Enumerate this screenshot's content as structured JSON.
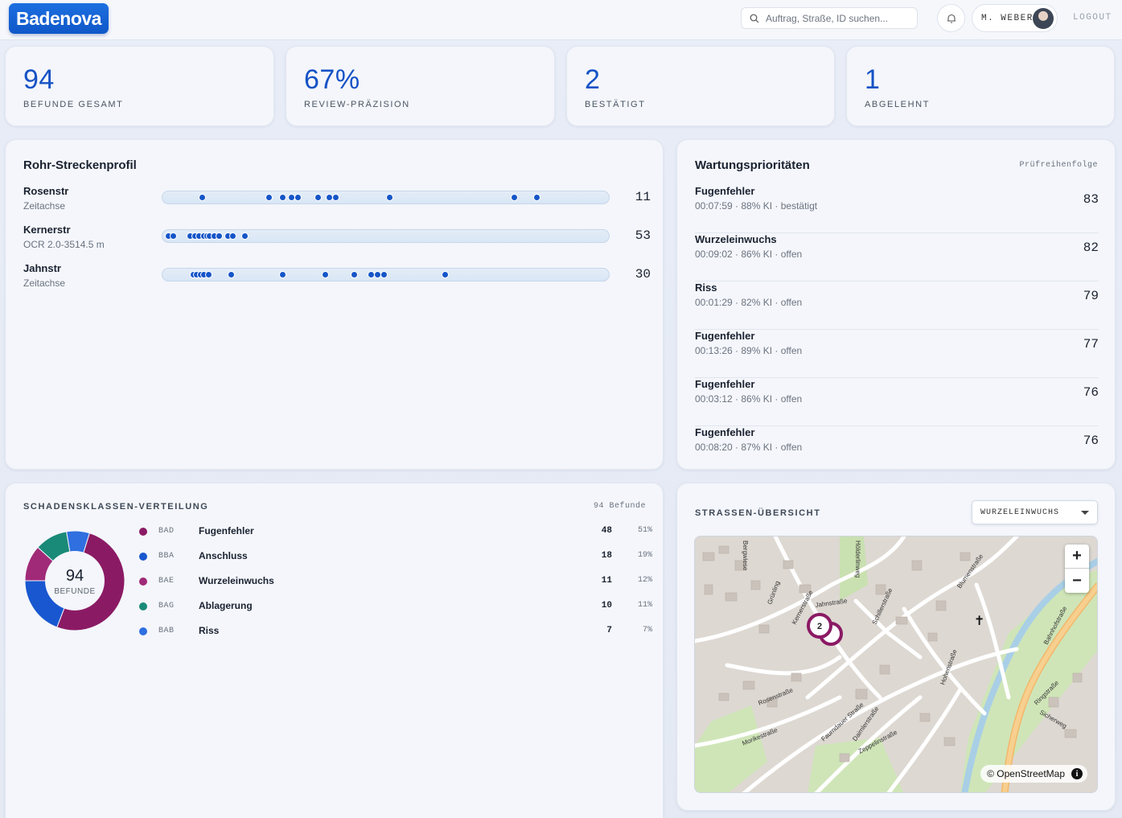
{
  "header": {
    "logo": "Badenova",
    "search_placeholder": "Auftrag, Straße, ID suchen...",
    "user": "M. WEBER",
    "logout": "LOGOUT"
  },
  "kpis": [
    {
      "value": "94",
      "label": "BEFUNDE GESAMT"
    },
    {
      "value": "67%",
      "label": "REVIEW-PRÄZISION"
    },
    {
      "value": "2",
      "label": "BESTÄTIGT"
    },
    {
      "value": "1",
      "label": "ABGELEHNT"
    }
  ],
  "profile": {
    "title": "Rohr-Streckenprofil",
    "rows": [
      {
        "name": "Rosenstr",
        "sub": "Zeitachse",
        "count": "11",
        "dots": [
          0.09,
          0.24,
          0.27,
          0.29,
          0.305,
          0.35,
          0.375,
          0.39,
          0.51,
          0.79,
          0.84
        ]
      },
      {
        "name": "Kernerstr",
        "sub": "OCR 2.0-3514.5 m",
        "count": "53",
        "dots": [
          0.015,
          0.025,
          0.063,
          0.073,
          0.083,
          0.093,
          0.1,
          0.107,
          0.118,
          0.128,
          0.148,
          0.158,
          0.185
        ]
      },
      {
        "name": "Jahnstr",
        "sub": "Zeitachse",
        "count": "30",
        "dots": [
          0.07,
          0.078,
          0.086,
          0.094,
          0.105,
          0.155,
          0.27,
          0.365,
          0.43,
          0.468,
          0.483,
          0.498,
          0.635
        ]
      }
    ]
  },
  "priorities": {
    "title": "Wartungsprioritäten",
    "subtitle": "Prüfreihenfolge",
    "items": [
      {
        "title": "Fugenfehler",
        "meta": "00:07:59 · 88% KI · bestätigt",
        "score": "83"
      },
      {
        "title": "Wurzeleinwuchs",
        "meta": "00:09:02 · 86% KI · offen",
        "score": "82"
      },
      {
        "title": "Riss",
        "meta": "00:01:29 · 82% KI · offen",
        "score": "79"
      },
      {
        "title": "Fugenfehler",
        "meta": "00:13:26 · 89% KI · offen",
        "score": "77"
      },
      {
        "title": "Fugenfehler",
        "meta": "00:03:12 · 86% KI · offen",
        "score": "76"
      },
      {
        "title": "Fugenfehler",
        "meta": "00:08:20 · 87% KI · offen",
        "score": "76"
      }
    ]
  },
  "distribution": {
    "title": "SCHADENSKLASSEN-VERTEILUNG",
    "total_label": "94 Befunde",
    "center_value": "94",
    "center_label": "BEFUNDE",
    "items": [
      {
        "code": "BAD",
        "name": "Fugenfehler",
        "count": "48",
        "pct": "51%",
        "color": "#8b1a64"
      },
      {
        "code": "BBA",
        "name": "Anschluss",
        "count": "18",
        "pct": "19%",
        "color": "#1857d0"
      },
      {
        "code": "BAE",
        "name": "Wurzeleinwuchs",
        "count": "11",
        "pct": "12%",
        "color": "#a02a78"
      },
      {
        "code": "BAG",
        "name": "Ablagerung",
        "count": "10",
        "pct": "11%",
        "color": "#1a8a78"
      },
      {
        "code": "BAB",
        "name": "Riss",
        "count": "7",
        "pct": "7%",
        "color": "#2f6fe0"
      }
    ]
  },
  "map": {
    "title": "STRASSEN-ÜBERSICHT",
    "filter_value": "WURZELEINWUCHS",
    "cluster_count": "2",
    "attribution": "© OpenStreetMap",
    "streets": [
      "Jahnstraße",
      "Kernerstraße",
      "Rosenstraße",
      "Morikestraße",
      "Schillerstraße",
      "Faurndauer Straße",
      "Hohenstraße",
      "Bahnhofstraße",
      "Ringstraße",
      "Sicherweg",
      "Zeppelinstraße",
      "Daimlerstraße",
      "Blumenstraße",
      "Bergwiese",
      "Grünling",
      "Hölderlinweg"
    ]
  }
}
